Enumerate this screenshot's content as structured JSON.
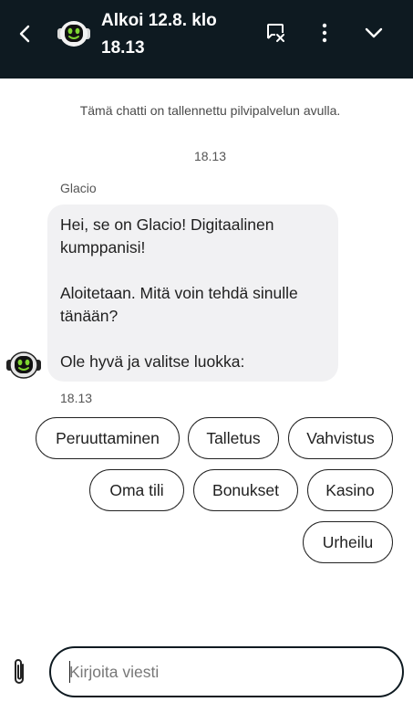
{
  "header": {
    "title": "Alkoi 12.8. klo 18.13",
    "back_icon": "chevron-left-icon",
    "end_chat_icon": "chat-close-icon",
    "menu_icon": "more-vertical-icon",
    "minimize_icon": "chevron-down-icon",
    "background": "#0e1a21"
  },
  "chat": {
    "notice": "Tämä chatti on tallennettu pilvipalvelun avulla.",
    "timestamp": "18.13",
    "sender": "Glacio",
    "message": {
      "line1": "Hei, se on Glacio! Digitaalinen kumppanisi!",
      "line2": "Aloitetaan. Mitä voin tehdä sinulle tänään?",
      "line3": "Ole hyvä ja valitse luokka:"
    },
    "message_time": "18.13"
  },
  "quick_replies": [
    "Peruuttaminen",
    "Talletus",
    "Vahvistus",
    "Oma tili",
    "Bonukset",
    "Kasino",
    "Urheilu"
  ],
  "composer": {
    "placeholder": "Kirjoita viesti",
    "value": "",
    "attach_icon": "paperclip-icon"
  },
  "colors": {
    "bot_accent": "#7fd631",
    "bubble": "#f1f1f3"
  }
}
